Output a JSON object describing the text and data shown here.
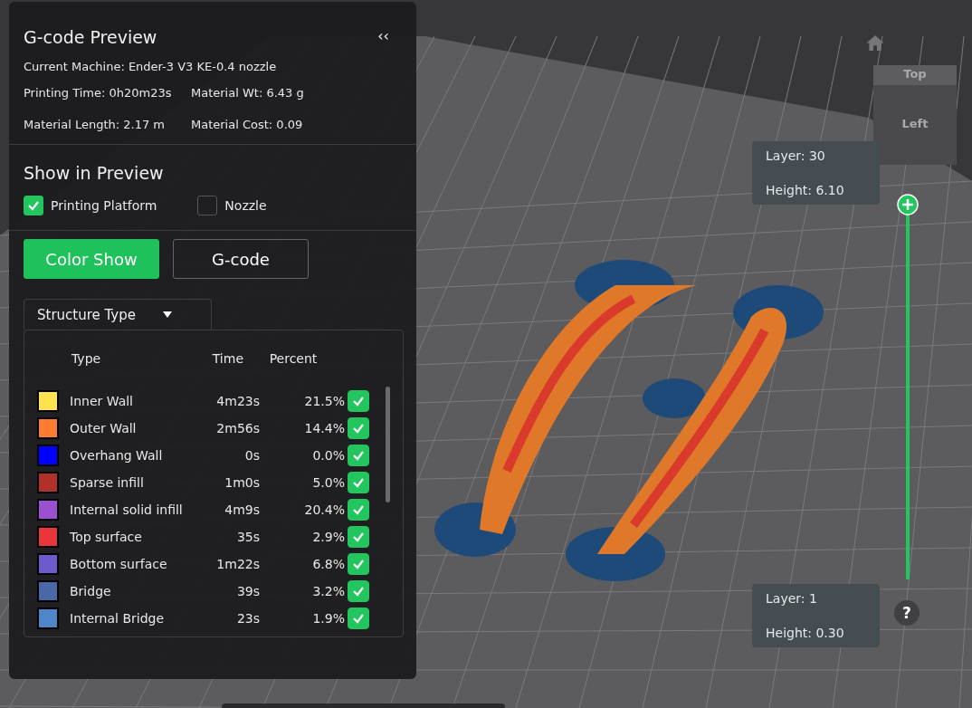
{
  "panel": {
    "title": "G-code Preview",
    "machine": "Current Machine: Ender-3 V3 KE-0.4 nozzle",
    "stats": [
      {
        "text": "Printing Time: 0h20m23s"
      },
      {
        "text": "Material Wt: 6.43 g"
      },
      {
        "text": "Material Length: 2.17 m"
      },
      {
        "text": "Material Cost: 0.09"
      }
    ],
    "collapse": "‹‹",
    "show_title": "Show in Preview",
    "options": [
      {
        "label": "Printing Platform",
        "checked": true
      },
      {
        "label": "Nozzle",
        "checked": false
      }
    ],
    "modes": [
      {
        "label": "Color Show",
        "selected": true
      },
      {
        "label": "G-code",
        "selected": false
      }
    ],
    "dropdown": "Structure Type",
    "columns": [
      "Type",
      "Time",
      "Percent"
    ],
    "rows": [
      {
        "type": "Inner Wall",
        "time": "4m23s",
        "percent": "21.5%",
        "color": "#ffe24d",
        "checked": true
      },
      {
        "type": "Outer Wall",
        "time": "2m56s",
        "percent": "14.4%",
        "color": "#ff7b33",
        "checked": true
      },
      {
        "type": "Overhang Wall",
        "time": "0s",
        "percent": "0.0%",
        "color": "#0000ff",
        "checked": true
      },
      {
        "type": "Sparse infill",
        "time": "1m0s",
        "percent": "5.0%",
        "color": "#b0302a",
        "checked": true
      },
      {
        "type": "Internal solid infill",
        "time": "4m9s",
        "percent": "20.4%",
        "color": "#9b4fd1",
        "checked": true
      },
      {
        "type": "Top surface",
        "time": "35s",
        "percent": "2.9%",
        "color": "#e8363a",
        "checked": true
      },
      {
        "type": "Bottom surface",
        "time": "1m22s",
        "percent": "6.8%",
        "color": "#6f5acd",
        "checked": true
      },
      {
        "type": "Bridge",
        "time": "39s",
        "percent": "3.2%",
        "color": "#4a67a8",
        "checked": true
      },
      {
        "type": "Internal Bridge",
        "time": "23s",
        "percent": "1.9%",
        "color": "#4d86c9",
        "checked": true
      }
    ]
  },
  "view_cube": {
    "top": "Top",
    "left": "Left"
  },
  "layer_top": {
    "layer": "Layer: 30",
    "height": "Height: 6.10"
  },
  "layer_bottom": {
    "layer": "Layer: 1",
    "height": "Height: 0.30"
  },
  "help": "?"
}
